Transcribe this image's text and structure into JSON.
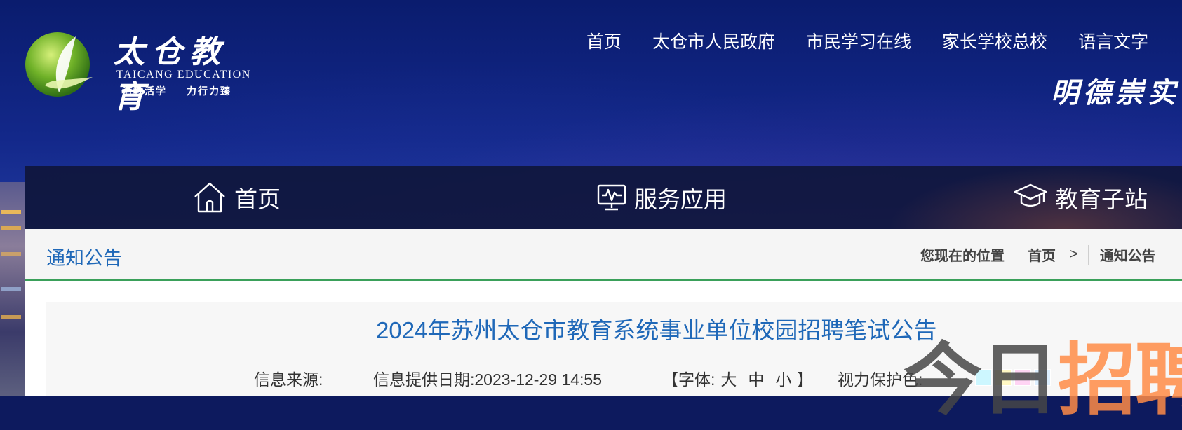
{
  "header": {
    "logo": {
      "name_cn": "太仓教育",
      "name_en": "TAICANG EDUCATION",
      "slogan_left": "活教活学",
      "slogan_right": "力行力臻"
    },
    "top_links": [
      "首页",
      "太仓市人民政府",
      "市民学习在线",
      "家长学校总校",
      "语言文字"
    ],
    "motto": "明德崇实·"
  },
  "nav": {
    "items": [
      {
        "label": "首页",
        "icon": "home-icon"
      },
      {
        "label": "服务应用",
        "icon": "monitor-icon"
      },
      {
        "label": "教育子站",
        "icon": "graduation-cap-icon"
      }
    ]
  },
  "section": {
    "title": "通知公告",
    "breadcrumb": {
      "label": "您现在的位置",
      "home": "首页",
      "separator": ">",
      "current": "通知公告"
    }
  },
  "article": {
    "title": "2024年苏州太仓市教育系统事业单位校园招聘笔试公告",
    "source_label": "信息来源:",
    "date_label": "信息提供日期:",
    "date_value": "2023-12-29 14:55",
    "font_open": "【字体:",
    "font_large": "大",
    "font_medium": "中",
    "font_small": "小",
    "font_close": "】",
    "eye_label": "视力保护色:",
    "eye_colors": [
      "#cdf7ff",
      "#fff8c4",
      "#ffd4f4",
      "#dcefff"
    ]
  },
  "watermark": {
    "part1": "今日",
    "part2": "招聘"
  },
  "colors": {
    "accent_blue": "#1f68b8",
    "divider_green": "#3aa05a",
    "nav_bg": "#0f1437"
  }
}
